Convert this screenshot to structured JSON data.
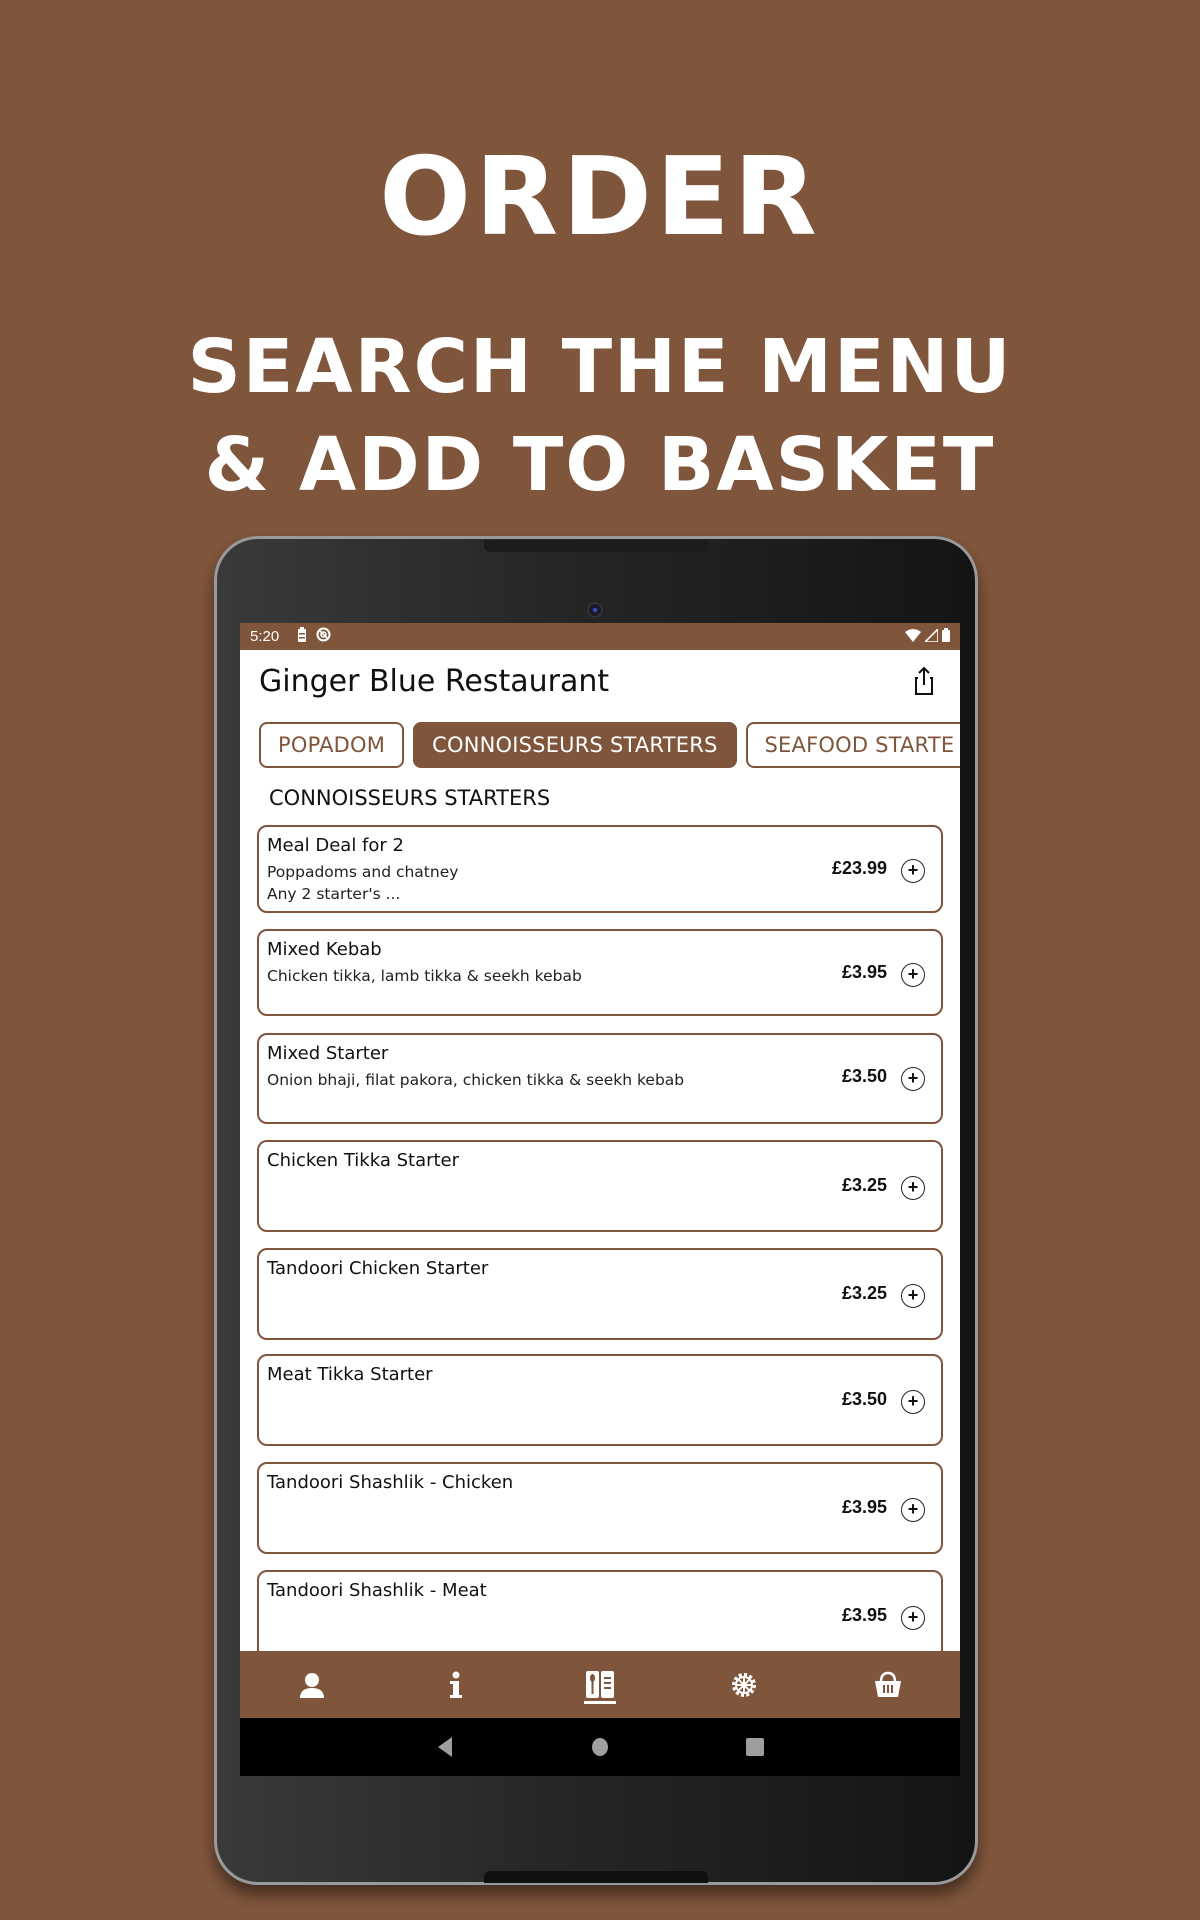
{
  "promo": {
    "title": "ORDER",
    "subtitle_line1": "SEARCH THE MENU",
    "subtitle_line2": "& ADD TO BASKET"
  },
  "colors": {
    "brand": "#7f553b",
    "background": "#7f553b",
    "text": "#111111"
  },
  "statusbar": {
    "time": "5:20",
    "left_icons": [
      "battery-saver-icon",
      "no-disturb-icon"
    ],
    "right_icons": [
      "wifi-icon",
      "cellular-signal-icon",
      "battery-icon"
    ]
  },
  "appbar": {
    "title": "Ginger Blue Restaurant",
    "share_icon": "share-icon"
  },
  "tabs": [
    {
      "label": "POPADOM",
      "active": false
    },
    {
      "label": "CONNOISSEURS STARTERS",
      "active": true
    },
    {
      "label": "SEAFOOD STARTE",
      "active": false
    }
  ],
  "section": {
    "heading": "CONNOISSEURS STARTERS"
  },
  "items": [
    {
      "name": "Meal Deal for 2",
      "desc_line1": "Poppadoms and chatney",
      "desc_line2": "Any 2 starter's ...",
      "price": "£23.99"
    },
    {
      "name": "Mixed Kebab",
      "desc_line1": "Chicken tikka, lamb tikka & seekh kebab",
      "desc_line2": "",
      "price": "£3.95"
    },
    {
      "name": "Mixed Starter",
      "desc_line1": "Onion bhaji, filat pakora, chicken tikka & seekh kebab",
      "desc_line2": "",
      "price": "£3.50"
    },
    {
      "name": "Chicken Tikka Starter",
      "desc_line1": "",
      "desc_line2": "",
      "price": "£3.25"
    },
    {
      "name": "Tandoori Chicken Starter",
      "desc_line1": "",
      "desc_line2": "",
      "price": "£3.25"
    },
    {
      "name": "Meat Tikka Starter",
      "desc_line1": "",
      "desc_line2": "",
      "price": "£3.50"
    },
    {
      "name": "Tandoori Shashlik - Chicken",
      "desc_line1": "",
      "desc_line2": "",
      "price": "£3.95"
    },
    {
      "name": "Tandoori Shashlik - Meat",
      "desc_line1": "",
      "desc_line2": "",
      "price": "£3.95"
    }
  ],
  "add_button_glyph": "+",
  "bottom_nav": [
    {
      "icon": "user-icon",
      "active": false
    },
    {
      "icon": "info-icon",
      "active": false
    },
    {
      "icon": "menu-book-icon",
      "active": true
    },
    {
      "icon": "settings-icon",
      "active": false
    },
    {
      "icon": "basket-icon",
      "active": false
    }
  ],
  "system_nav": [
    "back-icon",
    "home-icon",
    "recents-icon"
  ]
}
